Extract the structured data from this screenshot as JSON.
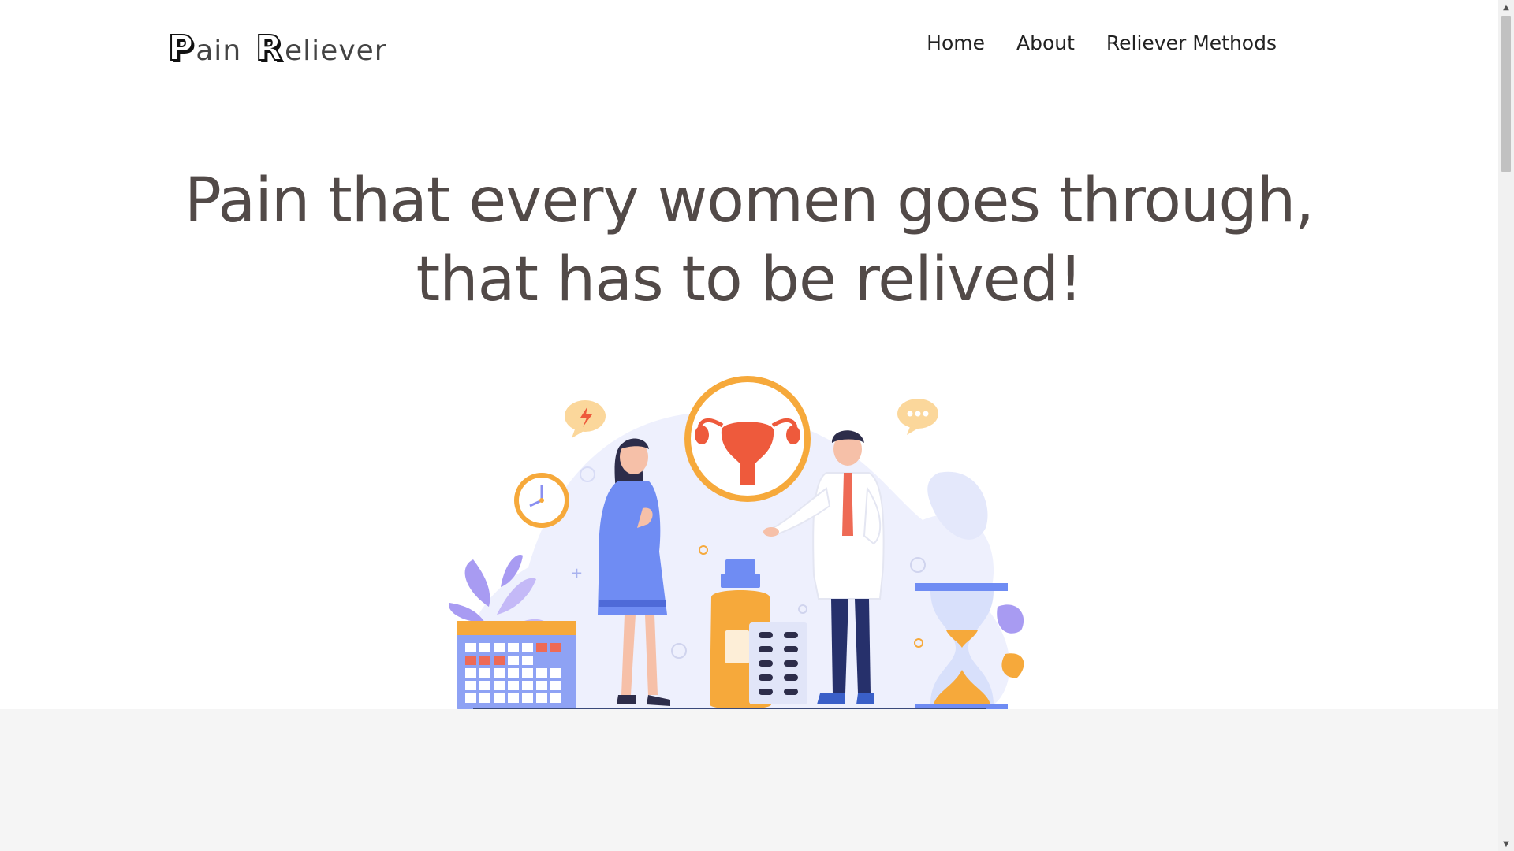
{
  "logo": {
    "word1_initial": "P",
    "word1_rest": "ain",
    "word2_initial": "R",
    "word2_rest": "eliever"
  },
  "nav": {
    "items": [
      "Home",
      "About",
      "Reliever Methods"
    ]
  },
  "hero": {
    "line1": "Pain that every women goes through,",
    "line2": "that has to be relived!"
  },
  "colors": {
    "heading": "#524a48",
    "accent_orange": "#f6a93b",
    "accent_blue": "#6f8cf3",
    "accent_purple": "#a89bf2",
    "accent_red": "#ee5a3c",
    "footer_bg": "#f5f5f5"
  },
  "illustration": {
    "icons": [
      "uterus-icon",
      "clock-icon",
      "calendar-icon",
      "hourglass-icon",
      "medicine-bottle-icon",
      "pill-blister-icon",
      "lightning-speech-bubble-icon",
      "ellipsis-speech-bubble-icon",
      "woman-figure",
      "doctor-figure",
      "leaf-plant-icon"
    ]
  },
  "scrollbar": {
    "up_arrow": "▲",
    "down_arrow": "▼"
  }
}
